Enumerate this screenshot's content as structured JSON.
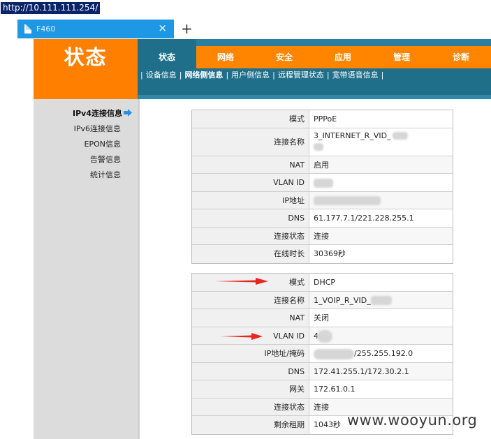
{
  "browser": {
    "address_url": "http://10.111.111.254/",
    "tab_title": "F460",
    "tab_close": "×",
    "new_tab": "+"
  },
  "header": {
    "brand_title": "状态",
    "nav": [
      "状态",
      "网络",
      "安全",
      "应用",
      "管理",
      "诊断"
    ],
    "active_nav_index": 0,
    "subnav": [
      "设备信息",
      "网络侧信息",
      "用户侧信息",
      "远程管理状态",
      "宽带语音信息"
    ],
    "active_subnav_index": 1,
    "subnav_separator": "|"
  },
  "sidebar": {
    "items": [
      "IPv4连接信息",
      "IPv6连接信息",
      "EPON信息",
      "告警信息",
      "统计信息"
    ],
    "active_index": 0
  },
  "connections": [
    {
      "rows": [
        {
          "label": "模式",
          "value": "PPPoE"
        },
        {
          "label": "连接名称",
          "value": "3_INTERNET_R_VID_"
        },
        {
          "label": "NAT",
          "value": "启用"
        },
        {
          "label": "VLAN ID",
          "value": ""
        },
        {
          "label": "IP地址",
          "value": ""
        },
        {
          "label": "DNS",
          "value": "61.177.7.1/221.228.255.1"
        },
        {
          "label": "连接状态",
          "value": "连接"
        },
        {
          "label": "在线时长",
          "value": "30369秒"
        }
      ]
    },
    {
      "rows": [
        {
          "label": "模式",
          "value": "DHCP"
        },
        {
          "label": "连接名称",
          "value": "1_VOIP_R_VID_"
        },
        {
          "label": "NAT",
          "value": "关闭"
        },
        {
          "label": "VLAN ID",
          "value": "4"
        },
        {
          "label": "IP地址/掩码",
          "value": "/255.255.192.0"
        },
        {
          "label": "DNS",
          "value": "172.41.255.1/172.30.2.1"
        },
        {
          "label": "网关",
          "value": "172.61.0.1"
        },
        {
          "label": "连接状态",
          "value": "连接"
        },
        {
          "label": "剩余租期",
          "value": "1043秒"
        }
      ]
    }
  ],
  "watermark": "www.wooyun.org",
  "colors": {
    "orange": "#ff7f00",
    "teal": "#1f6e8a",
    "tab_blue": "#1e97e4",
    "arrow_red": "#e8261f"
  }
}
